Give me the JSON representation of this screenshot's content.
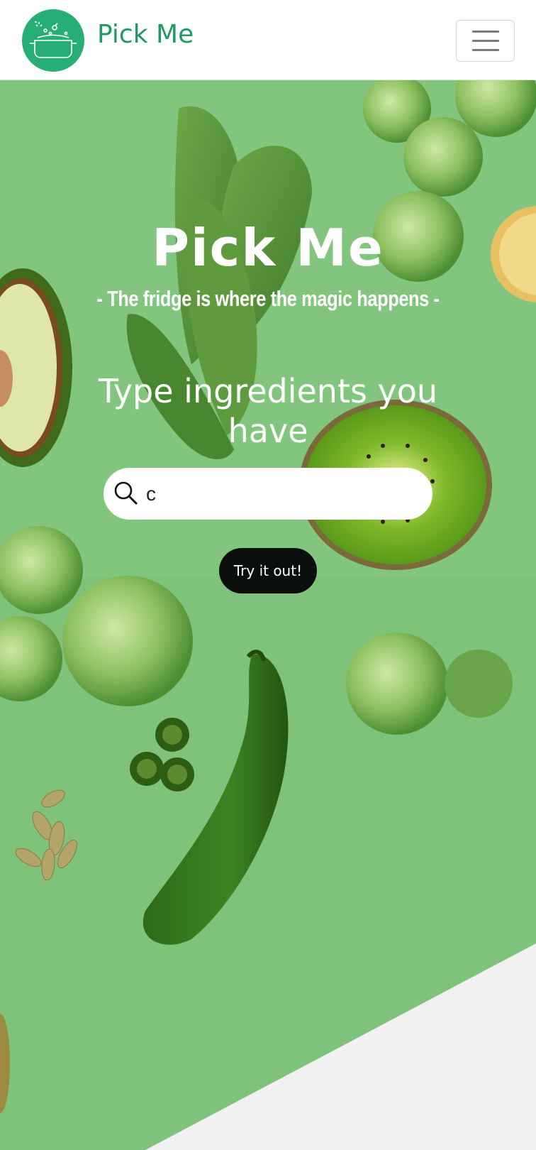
{
  "navbar": {
    "brand": "Pick Me",
    "logo_icon": "cooking-pot-icon",
    "menu_icon": "hamburger-menu-icon"
  },
  "hero": {
    "title": "Pick Me",
    "tagline": "- The fridge is where the magic happens -",
    "prompt": "Type ingredients you have",
    "search": {
      "value": "c",
      "icon": "search-icon"
    },
    "button_label": "Try it out!"
  },
  "colors": {
    "brand": "#27ae74",
    "brand_text": "#1f9a64",
    "hero_bg": "#7fc27c",
    "button_bg": "#0b0f0b",
    "footer_bg": "#f1f1f1"
  }
}
